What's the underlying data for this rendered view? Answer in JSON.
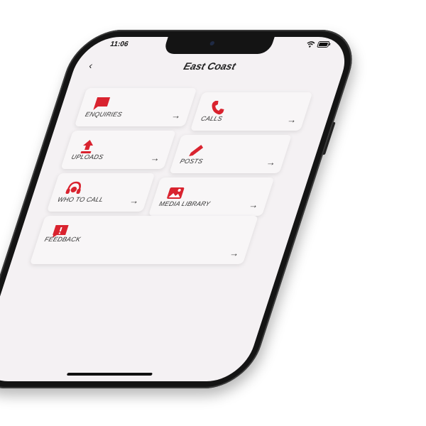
{
  "status": {
    "time": "11:06"
  },
  "header": {
    "back_label": "‹",
    "title": "East Coast"
  },
  "tiles": [
    {
      "label": "ENQUIRIES",
      "icon": "message-icon",
      "arrow": "→"
    },
    {
      "label": "CALLS",
      "icon": "phone-icon",
      "arrow": "→"
    },
    {
      "label": "UPLOADS",
      "icon": "upload-icon",
      "arrow": "→"
    },
    {
      "label": "POSTS",
      "icon": "pencil-icon",
      "arrow": "→"
    },
    {
      "label": "WHO TO CALL",
      "icon": "support-icon",
      "arrow": "→"
    },
    {
      "label": "MEDIA LIBRARY",
      "icon": "image-icon",
      "arrow": "→"
    },
    {
      "label": "FEEDBACK",
      "icon": "feedback-icon",
      "arrow": "→"
    }
  ],
  "colors": {
    "accent": "#d9232f",
    "background": "#f4f1f3"
  }
}
